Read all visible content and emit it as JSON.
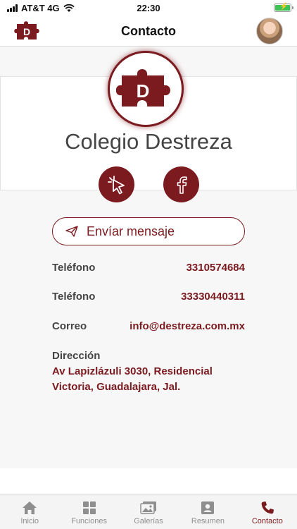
{
  "status_bar": {
    "carrier": "AT&T 4G",
    "time": "22:30"
  },
  "header": {
    "title": "Contacto",
    "logo_letter": "D"
  },
  "profile": {
    "logo_letter": "D",
    "name": "Colegio Destreza",
    "website_icon": "cursor-click-icon",
    "facebook_icon": "facebook-icon"
  },
  "message_button": {
    "label": "Envíar mensaje",
    "icon": "paper-plane-icon"
  },
  "contacts": [
    {
      "label": "Teléfono",
      "value": "3310574684"
    },
    {
      "label": "Teléfono",
      "value": "33330440311"
    },
    {
      "label": "Correo",
      "value": "info@destreza.com.mx"
    }
  ],
  "address": {
    "label": "Dirección",
    "line1": "Av Lapizlázuli 3030, Residencial",
    "line2": "Victoria, Guadalajara, Jal."
  },
  "tabs": [
    {
      "label": "Inicio",
      "icon": "home-icon"
    },
    {
      "label": "Funciones",
      "icon": "grid-icon"
    },
    {
      "label": "Galerías",
      "icon": "gallery-icon"
    },
    {
      "label": "Resumen",
      "icon": "profile-card-icon"
    },
    {
      "label": "Contacto",
      "icon": "phone-icon"
    }
  ],
  "colors": {
    "accent": "#7b1a1f",
    "inactive": "#8e8e8e",
    "battery": "#3bc454"
  }
}
